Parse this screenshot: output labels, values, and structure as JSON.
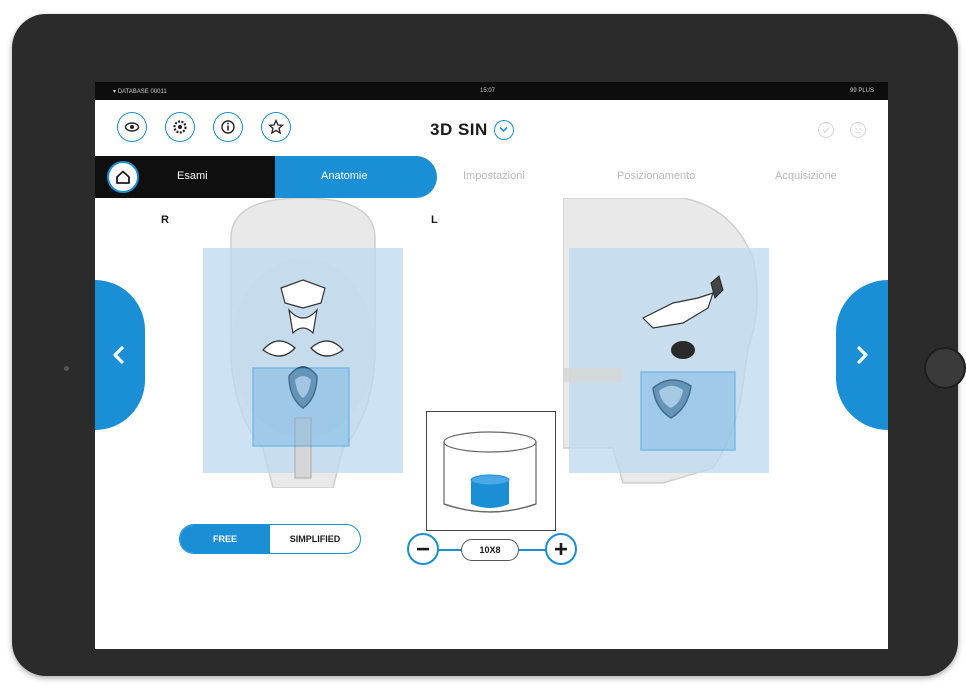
{
  "status_bar": {
    "left": "DATABASE 00011",
    "center": "15:07",
    "right": "99 PLUS"
  },
  "header": {
    "title": "3D SIN",
    "left_icons": [
      "eye-icon",
      "gear-icon",
      "info-icon",
      "star-icon"
    ],
    "right_icons": [
      "check-circle-icon",
      "face-circle-icon"
    ]
  },
  "tabs": {
    "home_icon": "home-icon",
    "items": [
      {
        "label": "Esami",
        "state": "completed"
      },
      {
        "label": "Anatomie",
        "state": "active"
      },
      {
        "label": "Impostazioni",
        "state": "inactive"
      },
      {
        "label": "Posizionamento",
        "state": "inactive"
      },
      {
        "label": "Acquisizione",
        "state": "inactive"
      }
    ]
  },
  "view": {
    "label_right": "R",
    "label_left": "L"
  },
  "mode_toggle": {
    "options": [
      "FREE",
      "SIMPLIFIED"
    ],
    "selected": "FREE"
  },
  "fov_stepper": {
    "value": "10X8",
    "minus_icon": "minus-icon",
    "plus_icon": "plus-icon"
  },
  "colors": {
    "accent": "#1a8fd6",
    "bezel": "#2b2b2b",
    "status_bar": "#0d0d0d"
  }
}
